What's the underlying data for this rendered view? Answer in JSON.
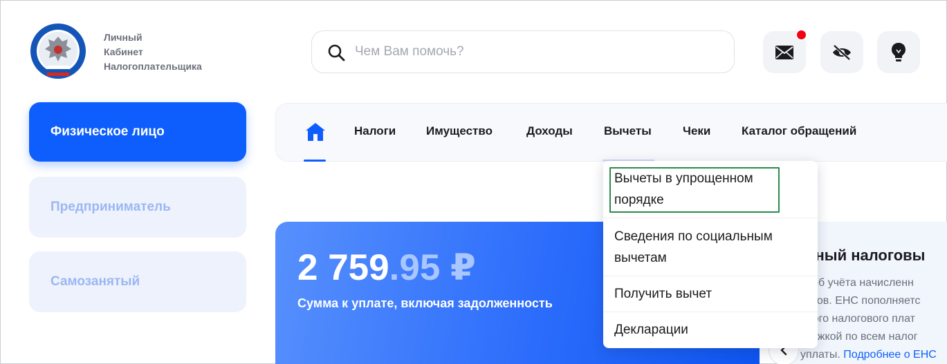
{
  "brand": {
    "line1": "Личный",
    "line2": "Кабинет",
    "line3": "Налогоплательщика",
    "logo_icon": "fns-emblem-icon"
  },
  "search": {
    "placeholder": "Чем Вам помочь?",
    "value": ""
  },
  "header_buttons": [
    {
      "icon": "mail-icon",
      "badge": true
    },
    {
      "icon": "eye-off-icon"
    },
    {
      "icon": "lightbulb-icon"
    }
  ],
  "sidebar": {
    "tabs": [
      {
        "label": "Физическое лицо",
        "active": true
      },
      {
        "label": "Предприниматель",
        "active": false
      },
      {
        "label": "Самозанятый",
        "active": false
      }
    ]
  },
  "nav": {
    "home_icon": "home-icon",
    "items": [
      "Налоги",
      "Имущество",
      "Доходы",
      "Вычеты",
      "Чеки",
      "Каталог обращений"
    ]
  },
  "dropdown": {
    "items": [
      {
        "line1": "Вычеты в упрощенном",
        "line2": "порядке"
      },
      {
        "line1": "Сведения по социальным",
        "line2": "вычетам"
      },
      {
        "line1": "Получить вычет",
        "line2": ""
      },
      {
        "line1": "Декларации",
        "line2": ""
      }
    ]
  },
  "payment_card": {
    "amount_int": "2 759",
    "amount_dec": ".95 ₽",
    "label": "Сумма к уплате, включая задолженность"
  },
  "ens_card": {
    "title": "диный налоговы",
    "lines": [
      "особ учёта начисленн",
      "логов. ЕНС пополняетс",
      "иного налогового плат",
      "атёжкой по всем налог"
    ],
    "last_text": "уплаты. ",
    "link": "Подробнее о ЕНС"
  },
  "colors": {
    "accent": "#0d5efc",
    "badge": "#f30014",
    "highlight": "#2c8a4b"
  }
}
